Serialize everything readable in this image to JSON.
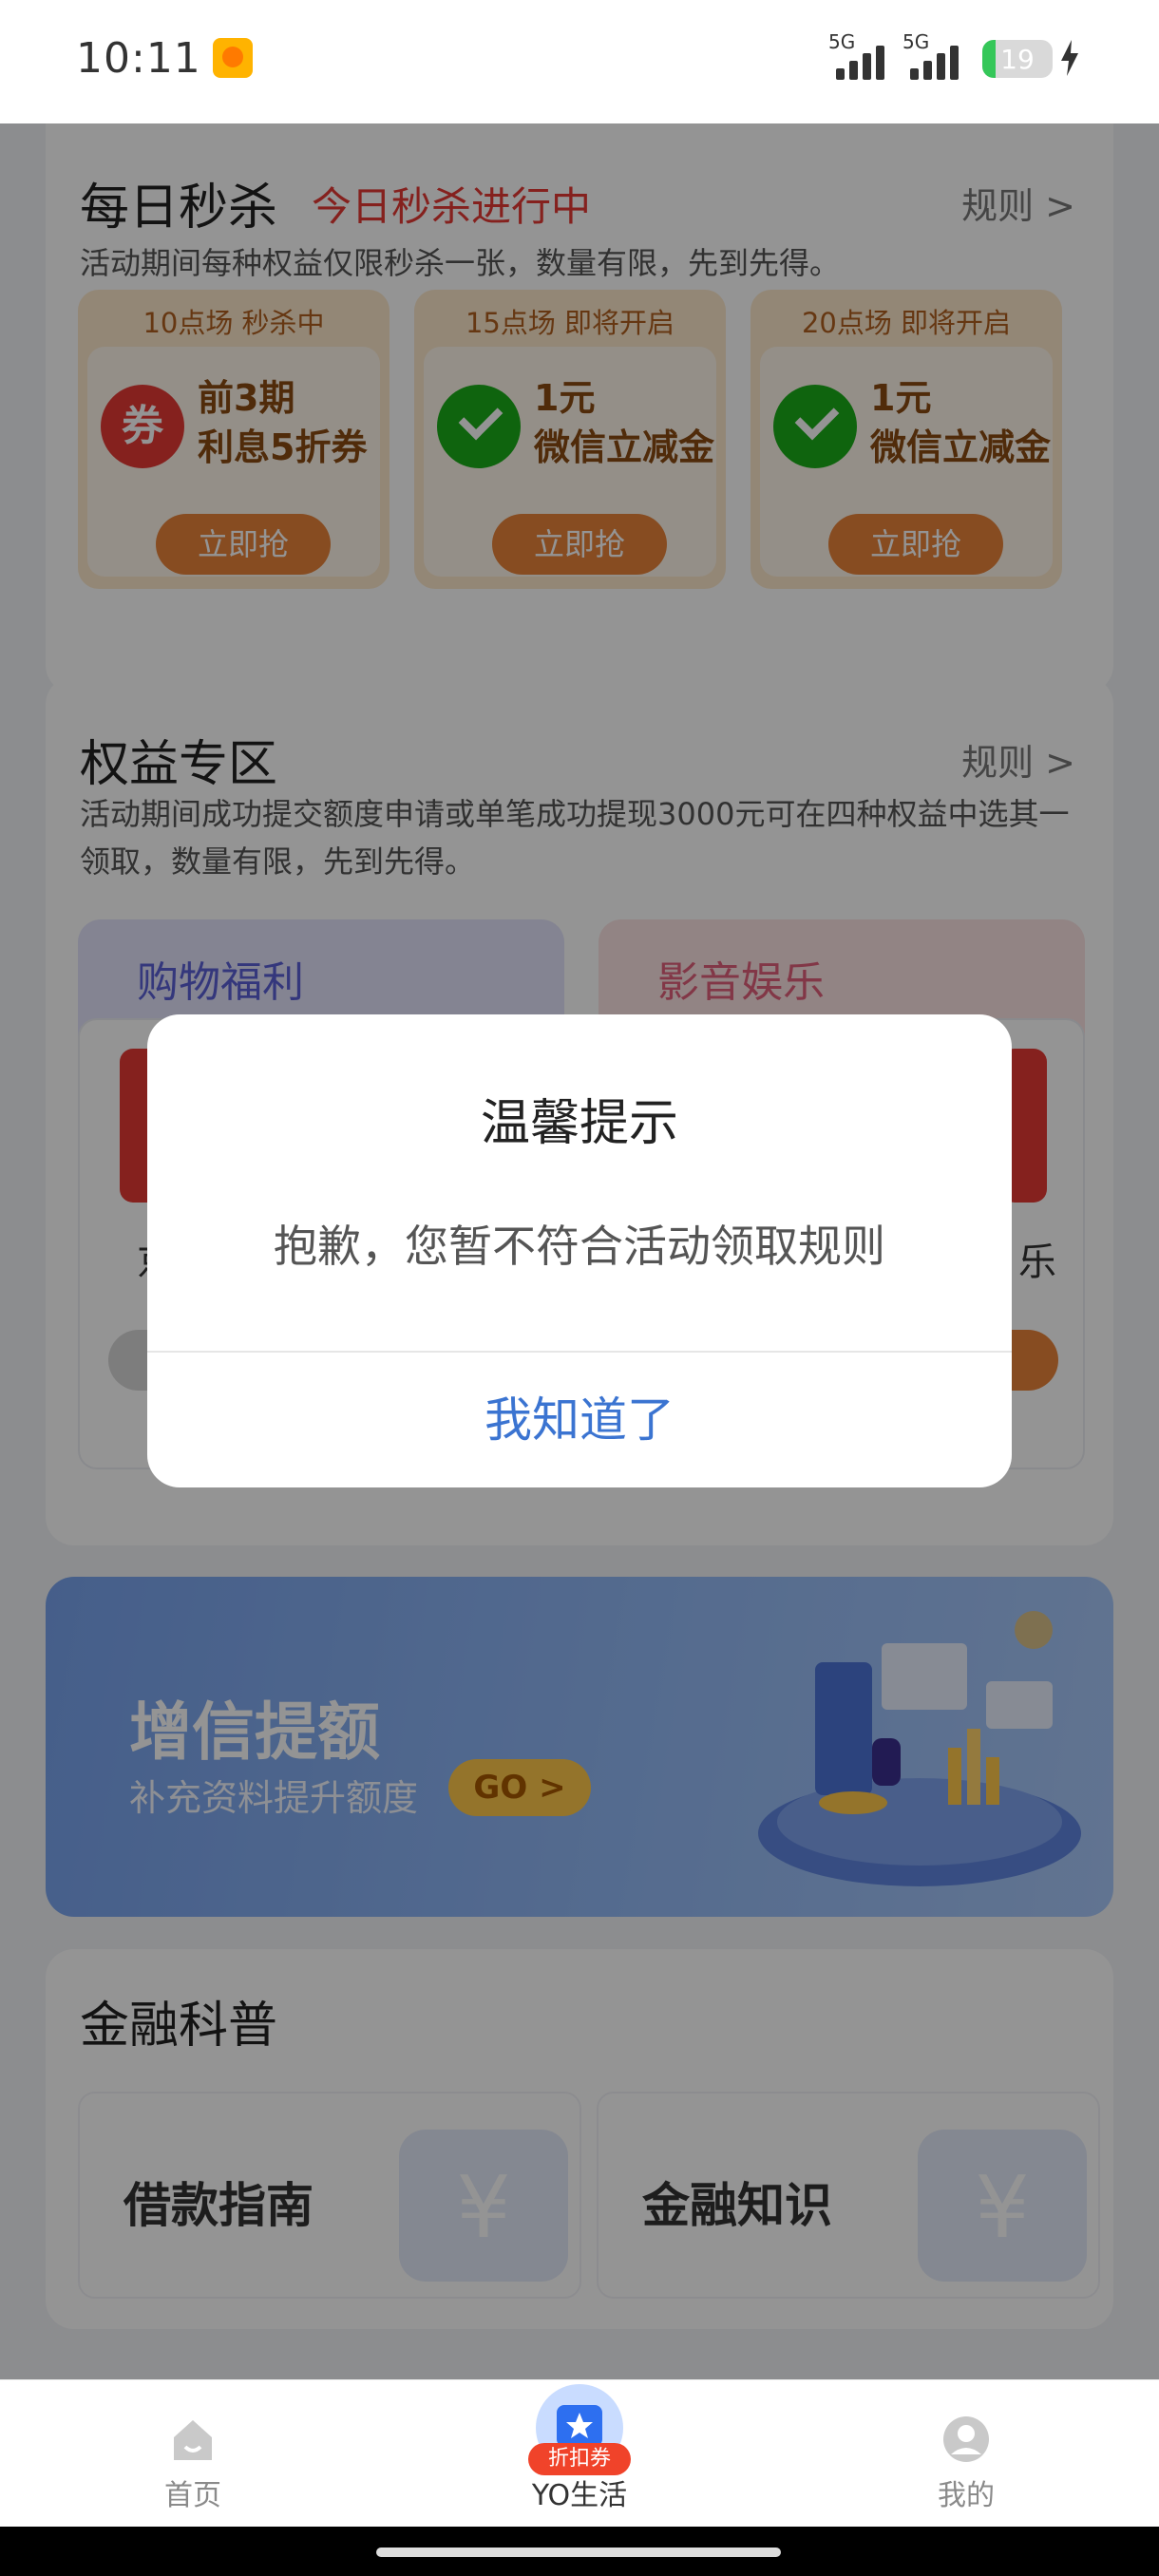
{
  "status_bar": {
    "time": "10:11",
    "signal_1": "5G",
    "signal_2": "5G",
    "battery": "19",
    "battery_level": 0.19
  },
  "flash_sale": {
    "title": "每日秒杀",
    "live": "今日秒杀进行中",
    "rule": "规则 >",
    "desc": "活动期间每种权益仅限秒杀一张，数量有限，先到先得。",
    "sessions": [
      {
        "header": "10点场 秒杀中",
        "line1": "前3期",
        "line2": "利息5折券",
        "icon": "coupon-icon",
        "icon_char": "券",
        "button": "立即抢"
      },
      {
        "header": "15点场 即将开启",
        "line1": "1元",
        "line2": "微信立减金",
        "icon": "wechat-icon",
        "button": "立即抢"
      },
      {
        "header": "20点场 即将开启",
        "line1": "1元",
        "line2": "微信立减金",
        "icon": "wechat-icon",
        "button": "立即抢"
      }
    ]
  },
  "benefits": {
    "title": "权益专区",
    "rule": "规则 >",
    "desc": "活动期间成功提交额度申请或单笔成功提现3000元可在四种权益中选其一领取，数量有限，先到先得。",
    "tabs": [
      "购物福利",
      "影音娱乐"
    ],
    "partial_left": "京",
    "partial_right": "乐"
  },
  "banner": {
    "title": "增信提额",
    "subtitle": "补充资料提升额度",
    "cta": "GO >"
  },
  "finance": {
    "title": "金融科普",
    "items": [
      {
        "label": "借款指南",
        "icon": "yen-document-icon"
      },
      {
        "label": "金融知识",
        "icon": "yen-book-icon"
      }
    ]
  },
  "dialog": {
    "title": "温馨提示",
    "message": "抱歉，您暂不符合活动领取规则",
    "ok": "我知道了"
  },
  "nav": {
    "home": "首页",
    "lifestyle": "YO生活",
    "lifestyle_badge": "折扣券",
    "mine": "我的"
  },
  "colors": {
    "accent_red": "#e53935",
    "dialog_button": "#3b74d1",
    "flash_button": "#e8833a",
    "banner_blue": "#78a3ee"
  }
}
